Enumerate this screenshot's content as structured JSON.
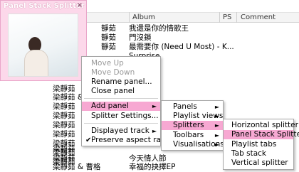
{
  "playlist": {
    "columns": {
      "album": "Album",
      "ps": "PS",
      "comment": "Comment"
    },
    "rows": [
      {
        "artist": "靜茹",
        "album": "我還是你的情歌王"
      },
      {
        "artist": "靜茹",
        "album": "門沒鎖"
      },
      {
        "artist": "靜茹",
        "album": "最需要你 (Need U Most) - K..."
      },
      {
        "artist": "",
        "album": "Surprise"
      },
      {
        "artist": "",
        "album": ""
      },
      {
        "artist": "",
        "album": ""
      },
      {
        "artist": "",
        "album": ""
      },
      {
        "artist": "梁靜茹",
        "album": ""
      },
      {
        "artist": "梁靜茹 &",
        "album": ""
      },
      {
        "artist": "梁靜茹",
        "album": ""
      },
      {
        "artist": "梁靜茹",
        "album": ""
      },
      {
        "artist": "梁靜茹",
        "album": ""
      },
      {
        "artist": "梁靜茹",
        "album": ""
      },
      {
        "artist": "梁靜茹",
        "album": ""
      },
      {
        "artist": "梁靜茹",
        "album": ""
      },
      {
        "artist": "梁靜茹",
        "album": ""
      },
      {
        "artist": "梁靜茹",
        "album": ""
      },
      {
        "artist": "梁靜茹",
        "album": "今天情人節"
      },
      {
        "artist": "梁靜茹 & 曹格",
        "album": "幸福的抉擇EP"
      }
    ]
  },
  "panel": {
    "title": "Panel Stack Splitter",
    "close": "×"
  },
  "menu_main": {
    "move_up": "Move Up",
    "move_down": "Move Down",
    "rename": "Rename panel...",
    "close": "Close panel",
    "add_panel": "Add panel",
    "splitter_settings": "Splitter Settings...",
    "displayed_track": "Displayed track",
    "preserve_aspect": "Preserve aspect ratio"
  },
  "menu_panels": {
    "panels": "Panels",
    "playlist_views": "Playlist views",
    "splitters": "Splitters",
    "toolbars": "Toolbars",
    "visualisations": "Visualisations"
  },
  "menu_splitters": {
    "horizontal": "Horizontal splitter",
    "panel_stack": "Panel Stack Splitter",
    "playlist_tabs": "Playlist tabs",
    "tab_stack": "Tab stack",
    "vertical": "Vertical splitter"
  },
  "colors": {
    "highlight": "#f7a8d2",
    "panel_bg": "#fcd8ea"
  }
}
